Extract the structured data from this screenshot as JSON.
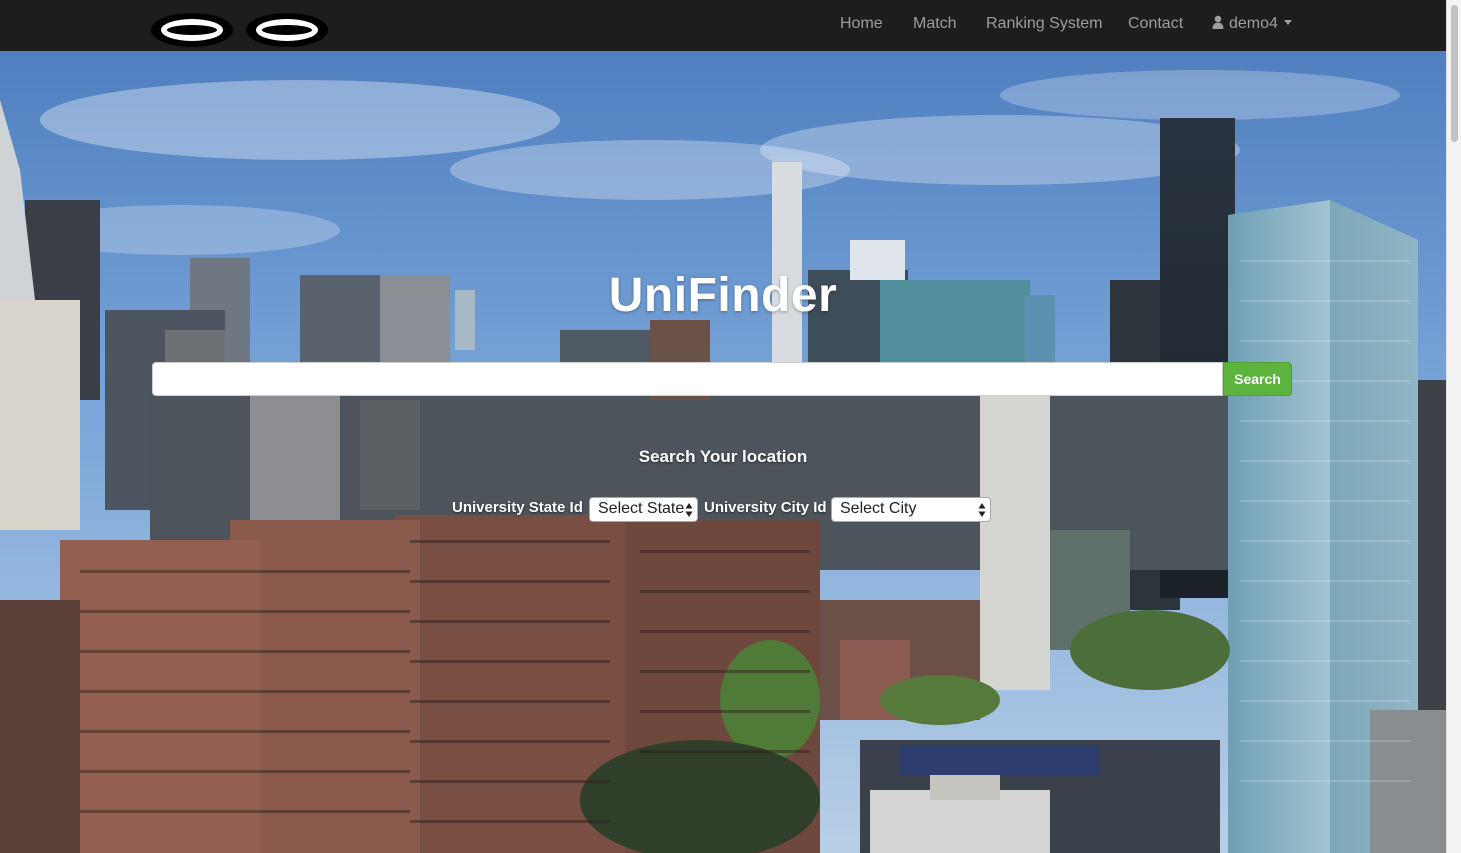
{
  "navbar": {
    "logos": [
      {
        "icon": "ring-logo-icon"
      },
      {
        "icon": "ring-logo-icon"
      }
    ],
    "links": {
      "home": "Home",
      "match": "Match",
      "ranking": "Ranking System",
      "contact": "Contact"
    },
    "user": {
      "icon": "user-icon",
      "name": "demo4",
      "dropdown_icon": "caret-down-icon"
    },
    "background_color": "#1d1d1d",
    "link_color": "#9d9d9d"
  },
  "hero": {
    "title": "UniFinder",
    "search": {
      "value": "",
      "placeholder": "",
      "button_label": "Search",
      "button_color": "#5cb43e"
    },
    "location": {
      "heading": "Search Your location",
      "state_label": "University State Id",
      "state_selected": "Select State",
      "city_label": "University City Id",
      "city_selected": "Select City"
    }
  }
}
